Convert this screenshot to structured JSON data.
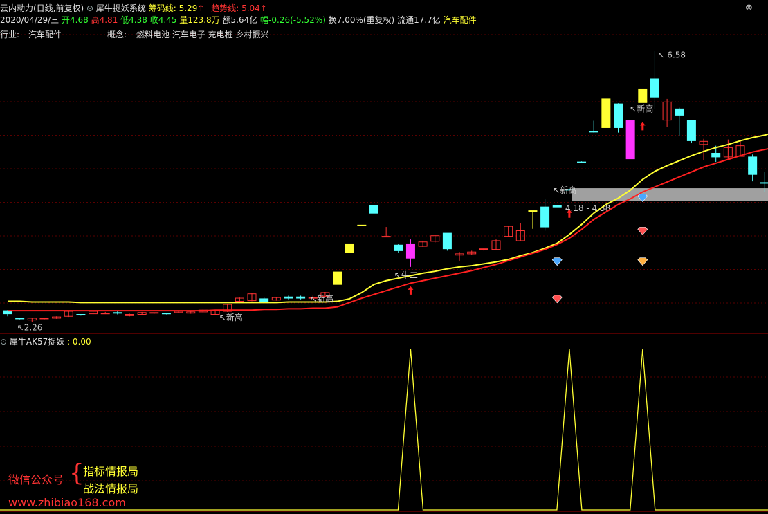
{
  "header": {
    "stock_name": "云内动力(日线,前复权)",
    "indicator_name": "犀牛捉妖系统",
    "chip_label": "筹码线: 5.29",
    "chip_arrow": "↑",
    "trend_label": "趋势线: 5.04",
    "trend_arrow": "↑",
    "date": "2020/04/29/三",
    "open": "开4.68",
    "high": "高4.81",
    "low": "低4.38",
    "close": "收4.45",
    "volume": "量123.8万",
    "amount": "额5.64亿",
    "change": "幅-0.26(-5.52%)",
    "turnover": "换7.00%(重复权)",
    "float_shares": "流通17.7亿",
    "industry_tag": "汽车配件"
  },
  "info": {
    "industry_label": "行业:",
    "industry_value": "汽车配件",
    "concept_label": "概念:",
    "concept_value": "燃料电池 汽车电子 充电桩 乡村振兴"
  },
  "annotations": {
    "high_price": "6.58",
    "low_price": "2.26",
    "zone_range": "4.18 - 4.38",
    "new_high": "新高",
    "niu_er": "牛二"
  },
  "sub": {
    "name": "犀牛AK57捉妖",
    "value": ": 0.00"
  },
  "watermark": {
    "wechat": "微信公众号",
    "brace": "{",
    "line1": "指标情报局",
    "line2": "战法情报局",
    "url": "www.zhibiao168.com"
  },
  "colors": {
    "up": "#ff3333",
    "down": "#54ffff",
    "yellow": "#ffff33",
    "magenta": "#ff33ff",
    "chip_line": "#ffff33",
    "trend_line": "#ff2020",
    "grid": "#5a0000",
    "zone": "#a0a0a0"
  },
  "chart_data": {
    "type": "candlestick",
    "price_range": [
      2.1,
      6.75
    ],
    "bars": [
      {
        "o": 2.37,
        "h": 2.43,
        "l": 2.33,
        "c": 2.42,
        "t": "down"
      },
      {
        "o": 2.3,
        "h": 2.31,
        "l": 2.28,
        "c": 2.3,
        "t": "down"
      },
      {
        "o": 2.27,
        "h": 2.31,
        "l": 2.24,
        "c": 2.3,
        "t": "up"
      },
      {
        "o": 2.3,
        "h": 2.31,
        "l": 2.28,
        "c": 2.3,
        "t": "up"
      },
      {
        "o": 2.3,
        "h": 2.33,
        "l": 2.29,
        "c": 2.32,
        "t": "up"
      },
      {
        "o": 2.33,
        "h": 2.42,
        "l": 2.32,
        "c": 2.41,
        "t": "up"
      },
      {
        "o": 2.36,
        "h": 2.36,
        "l": 2.34,
        "c": 2.35,
        "t": "down"
      },
      {
        "o": 2.37,
        "h": 2.42,
        "l": 2.36,
        "c": 2.41,
        "t": "up"
      },
      {
        "o": 2.38,
        "h": 2.4,
        "l": 2.37,
        "c": 2.38,
        "t": "up"
      },
      {
        "o": 2.38,
        "h": 2.41,
        "l": 2.36,
        "c": 2.39,
        "t": "down"
      },
      {
        "o": 2.34,
        "h": 2.37,
        "l": 2.33,
        "c": 2.36,
        "t": "up"
      },
      {
        "o": 2.36,
        "h": 2.4,
        "l": 2.35,
        "c": 2.39,
        "t": "up"
      },
      {
        "o": 2.39,
        "h": 2.39,
        "l": 2.37,
        "c": 2.38,
        "t": "up"
      },
      {
        "o": 2.38,
        "h": 2.38,
        "l": 2.36,
        "c": 2.37,
        "t": "down"
      },
      {
        "o": 2.39,
        "h": 2.42,
        "l": 2.38,
        "c": 2.41,
        "t": "up"
      },
      {
        "o": 2.38,
        "h": 2.41,
        "l": 2.37,
        "c": 2.4,
        "t": "up"
      },
      {
        "o": 2.4,
        "h": 2.44,
        "l": 2.39,
        "c": 2.43,
        "t": "up"
      },
      {
        "o": 2.36,
        "h": 2.43,
        "l": 2.35,
        "c": 2.43,
        "t": "up"
      },
      {
        "o": 2.41,
        "h": 2.52,
        "l": 2.4,
        "c": 2.52,
        "t": "up"
      },
      {
        "o": 2.57,
        "h": 2.63,
        "l": 2.56,
        "c": 2.62,
        "t": "up"
      },
      {
        "o": 2.58,
        "h": 2.7,
        "l": 2.57,
        "c": 2.69,
        "t": "up"
      },
      {
        "o": 2.61,
        "h": 2.63,
        "l": 2.56,
        "c": 2.57,
        "t": "down"
      },
      {
        "o": 2.59,
        "h": 2.64,
        "l": 2.58,
        "c": 2.63,
        "t": "up"
      },
      {
        "o": 2.64,
        "h": 2.66,
        "l": 2.6,
        "c": 2.62,
        "t": "down"
      },
      {
        "o": 2.64,
        "h": 2.66,
        "l": 2.6,
        "c": 2.62,
        "t": "down"
      },
      {
        "o": 2.63,
        "h": 2.66,
        "l": 2.61,
        "c": 2.63,
        "t": "up"
      },
      {
        "o": 2.65,
        "h": 2.72,
        "l": 2.64,
        "c": 2.71,
        "t": "up"
      },
      {
        "o": 2.84,
        "h": 3.04,
        "l": 2.84,
        "c": 3.04,
        "t": "yellow"
      },
      {
        "o": 3.35,
        "h": 3.49,
        "l": 3.35,
        "c": 3.49,
        "t": "yellow"
      },
      {
        "o": 3.79,
        "h": 3.79,
        "l": 3.78,
        "c": 3.79,
        "t": "yellow"
      },
      {
        "o": 4.1,
        "h": 4.11,
        "l": 3.81,
        "c": 3.98,
        "t": "down"
      },
      {
        "o": 3.6,
        "h": 3.76,
        "l": 3.6,
        "c": 3.61,
        "t": "up"
      },
      {
        "o": 3.47,
        "h": 3.49,
        "l": 3.35,
        "c": 3.38,
        "t": "down"
      },
      {
        "o": 3.49,
        "h": 3.56,
        "l": 3.12,
        "c": 3.26,
        "t": "magenta"
      },
      {
        "o": 3.45,
        "h": 3.54,
        "l": 3.44,
        "c": 3.52,
        "t": "up"
      },
      {
        "o": 3.53,
        "h": 3.63,
        "l": 3.51,
        "c": 3.62,
        "t": "up"
      },
      {
        "o": 3.66,
        "h": 3.66,
        "l": 3.38,
        "c": 3.41,
        "t": "down"
      },
      {
        "o": 3.31,
        "h": 3.36,
        "l": 3.22,
        "c": 3.33,
        "t": "up"
      },
      {
        "o": 3.33,
        "h": 3.38,
        "l": 3.31,
        "c": 3.36,
        "t": "up"
      },
      {
        "o": 3.41,
        "h": 3.42,
        "l": 3.38,
        "c": 3.41,
        "t": "up"
      },
      {
        "o": 3.4,
        "h": 3.56,
        "l": 3.39,
        "c": 3.54,
        "t": "up"
      },
      {
        "o": 3.61,
        "h": 3.78,
        "l": 3.6,
        "c": 3.77,
        "t": "up"
      },
      {
        "o": 3.54,
        "h": 3.82,
        "l": 3.53,
        "c": 3.7,
        "t": "up"
      },
      {
        "o": 4.02,
        "h": 4.02,
        "l": 3.73,
        "c": 4.02,
        "t": "yellow"
      },
      {
        "o": 4.08,
        "h": 4.21,
        "l": 3.7,
        "c": 3.76,
        "t": "down"
      },
      {
        "o": 4.1,
        "h": 4.1,
        "l": 4.08,
        "c": 4.08,
        "t": "down"
      },
      {
        "o": 4.36,
        "h": 4.37,
        "l": 4.35,
        "c": 4.36,
        "t": "down"
      },
      {
        "o": 4.8,
        "h": 4.81,
        "l": 4.79,
        "c": 4.8,
        "t": "down"
      },
      {
        "o": 5.28,
        "h": 5.46,
        "l": 5.27,
        "c": 5.29,
        "t": "down"
      },
      {
        "o": 5.81,
        "h": 5.81,
        "l": 5.35,
        "c": 5.35,
        "t": "yellow"
      },
      {
        "o": 5.73,
        "h": 5.74,
        "l": 5.27,
        "c": 5.35,
        "t": "down"
      },
      {
        "o": 5.46,
        "h": 5.46,
        "l": 4.85,
        "c": 4.85,
        "t": "magenta"
      },
      {
        "o": 5.97,
        "h": 5.97,
        "l": 5.75,
        "c": 5.75,
        "t": "yellow"
      },
      {
        "o": 6.13,
        "h": 6.58,
        "l": 5.65,
        "c": 5.84,
        "t": "down"
      },
      {
        "o": 5.47,
        "h": 5.81,
        "l": 5.36,
        "c": 5.76,
        "t": "up"
      },
      {
        "o": 5.65,
        "h": 5.67,
        "l": 5.22,
        "c": 5.55,
        "t": "down"
      },
      {
        "o": 5.47,
        "h": 5.47,
        "l": 5.1,
        "c": 5.14,
        "t": "down"
      },
      {
        "o": 5.08,
        "h": 5.17,
        "l": 4.83,
        "c": 5.13,
        "t": "up"
      },
      {
        "o": 4.94,
        "h": 5.06,
        "l": 4.8,
        "c": 4.88,
        "t": "down"
      },
      {
        "o": 4.88,
        "h": 5.16,
        "l": 4.85,
        "c": 5.03,
        "t": "up"
      },
      {
        "o": 4.89,
        "h": 5.14,
        "l": 4.89,
        "c": 5.06,
        "t": "up"
      },
      {
        "o": 4.88,
        "h": 4.92,
        "l": 4.49,
        "c": 4.6,
        "t": "down"
      },
      {
        "o": 4.47,
        "h": 4.64,
        "l": 4.32,
        "c": 4.47,
        "t": "down"
      },
      {
        "o": 4.41,
        "h": 4.62,
        "l": 4.27,
        "c": 4.38,
        "t": "down"
      }
    ],
    "chip_line": [
      2.57,
      2.57,
      2.56,
      2.56,
      2.56,
      2.56,
      2.55,
      2.55,
      2.55,
      2.55,
      2.55,
      2.55,
      2.55,
      2.55,
      2.55,
      2.55,
      2.55,
      2.55,
      2.55,
      2.55,
      2.55,
      2.55,
      2.55,
      2.56,
      2.56,
      2.56,
      2.56,
      2.57,
      2.61,
      2.71,
      2.84,
      2.9,
      2.94,
      2.98,
      3.02,
      3.05,
      3.09,
      3.12,
      3.14,
      3.17,
      3.2,
      3.24,
      3.3,
      3.35,
      3.42,
      3.5,
      3.64,
      3.8,
      3.98,
      4.12,
      4.22,
      4.35,
      4.52,
      4.65,
      4.74,
      4.82,
      4.9,
      4.97,
      5.03,
      5.08,
      5.14,
      5.19,
      5.23,
      5.29
    ],
    "trend_line": [
      2.42,
      2.42,
      2.42,
      2.42,
      2.42,
      2.42,
      2.42,
      2.42,
      2.42,
      2.42,
      2.42,
      2.42,
      2.42,
      2.42,
      2.42,
      2.42,
      2.42,
      2.43,
      2.43,
      2.43,
      2.43,
      2.44,
      2.44,
      2.45,
      2.45,
      2.46,
      2.46,
      2.48,
      2.55,
      2.62,
      2.68,
      2.74,
      2.8,
      2.86,
      2.9,
      2.94,
      2.98,
      3.02,
      3.06,
      3.11,
      3.16,
      3.22,
      3.28,
      3.34,
      3.4,
      3.48,
      3.58,
      3.72,
      3.88,
      4.0,
      4.12,
      4.21,
      4.32,
      4.4,
      4.48,
      4.56,
      4.64,
      4.72,
      4.78,
      4.84,
      4.9,
      4.96,
      5.0,
      5.04
    ],
    "up_arrows": [
      33,
      46,
      52
    ],
    "diamonds": [
      {
        "i": 45,
        "price": 3.2,
        "color": "blue"
      },
      {
        "i": 52,
        "price": 4.22,
        "color": "blue"
      },
      {
        "i": 52,
        "price": 3.69,
        "color": "red"
      },
      {
        "i": 45,
        "price": 2.6,
        "color": "red"
      },
      {
        "i": 52,
        "price": 3.2,
        "color": "orange"
      }
    ],
    "zone": {
      "low": 4.18,
      "high": 4.38,
      "start_index": 46
    },
    "sub_indicator": {
      "name": "犀牛AK57捉妖",
      "range": [
        0,
        1
      ],
      "peaks": [
        33,
        46,
        52
      ],
      "values_default": 0
    }
  }
}
